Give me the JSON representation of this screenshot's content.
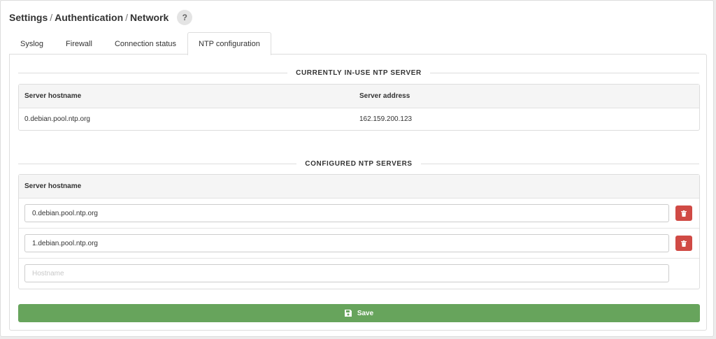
{
  "breadcrumb": {
    "items": [
      "Settings",
      "Authentication",
      "Network"
    ],
    "separator": "/"
  },
  "help": {
    "label": "?"
  },
  "tabs": [
    {
      "label": "Syslog"
    },
    {
      "label": "Firewall"
    },
    {
      "label": "Connection status"
    },
    {
      "label": "NTP configuration",
      "active": true
    }
  ],
  "in_use": {
    "title": "CURRENTLY IN-USE NTP SERVER",
    "columns": [
      "Server hostname",
      "Server address"
    ],
    "row": {
      "hostname": "0.debian.pool.ntp.org",
      "address": "162.159.200.123"
    }
  },
  "configured": {
    "title": "CONFIGURED NTP SERVERS",
    "column": "Server hostname",
    "servers": [
      "0.debian.pool.ntp.org",
      "1.debian.pool.ntp.org"
    ],
    "new_placeholder": "Hostname"
  },
  "save": {
    "label": "Save",
    "icon": "floppy-disk-icon"
  },
  "colors": {
    "save": "#67a45c",
    "delete": "#d04a45",
    "border": "#dddddd"
  }
}
